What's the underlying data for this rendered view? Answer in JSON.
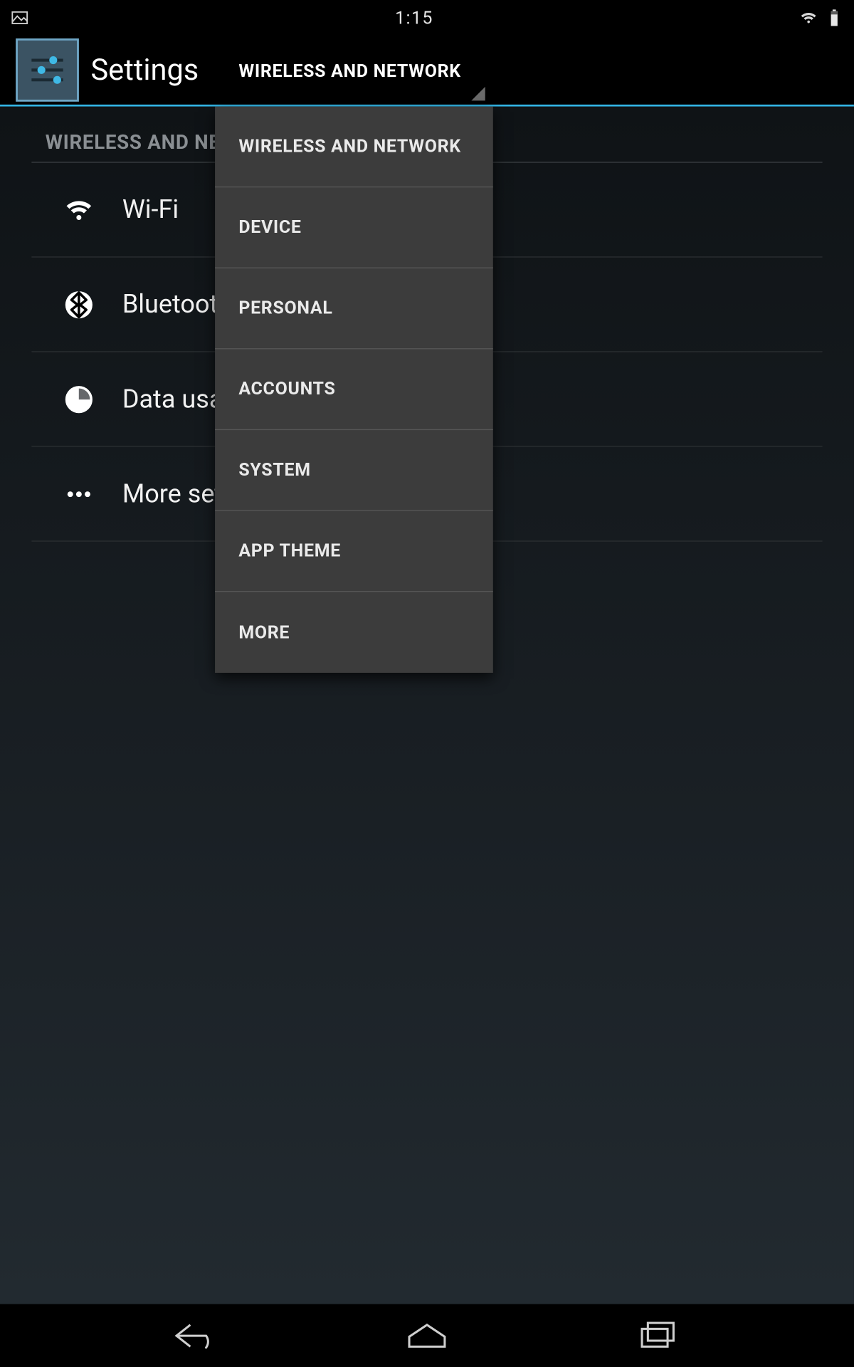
{
  "statusbar": {
    "time": "1:15",
    "icons": {
      "left_image_indicator": "image-icon",
      "wifi": "wifi-icon",
      "battery": "battery-icon"
    }
  },
  "actionbar": {
    "title": "Settings",
    "spinner_selected": "WIRELESS AND NETWORK"
  },
  "section_header": "WIRELESS AND NETWORK",
  "settings_rows": [
    {
      "icon": "wifi-icon",
      "label": "Wi-Fi"
    },
    {
      "icon": "bluetooth-icon",
      "label": "Bluetooth"
    },
    {
      "icon": "data-usage-icon",
      "label": "Data usage"
    },
    {
      "icon": "more-icon",
      "label": "More settings"
    }
  ],
  "dropdown": {
    "items": [
      "WIRELESS AND NETWORK",
      "DEVICE",
      "PERSONAL",
      "ACCOUNTS",
      "SYSTEM",
      "APP THEME",
      "MORE"
    ]
  },
  "navbar": {
    "back": "back-icon",
    "home": "home-icon",
    "recent": "recent-apps-icon"
  },
  "colors": {
    "holo_blue": "#33b5e5",
    "dropdown_bg": "#3c3c3c"
  }
}
